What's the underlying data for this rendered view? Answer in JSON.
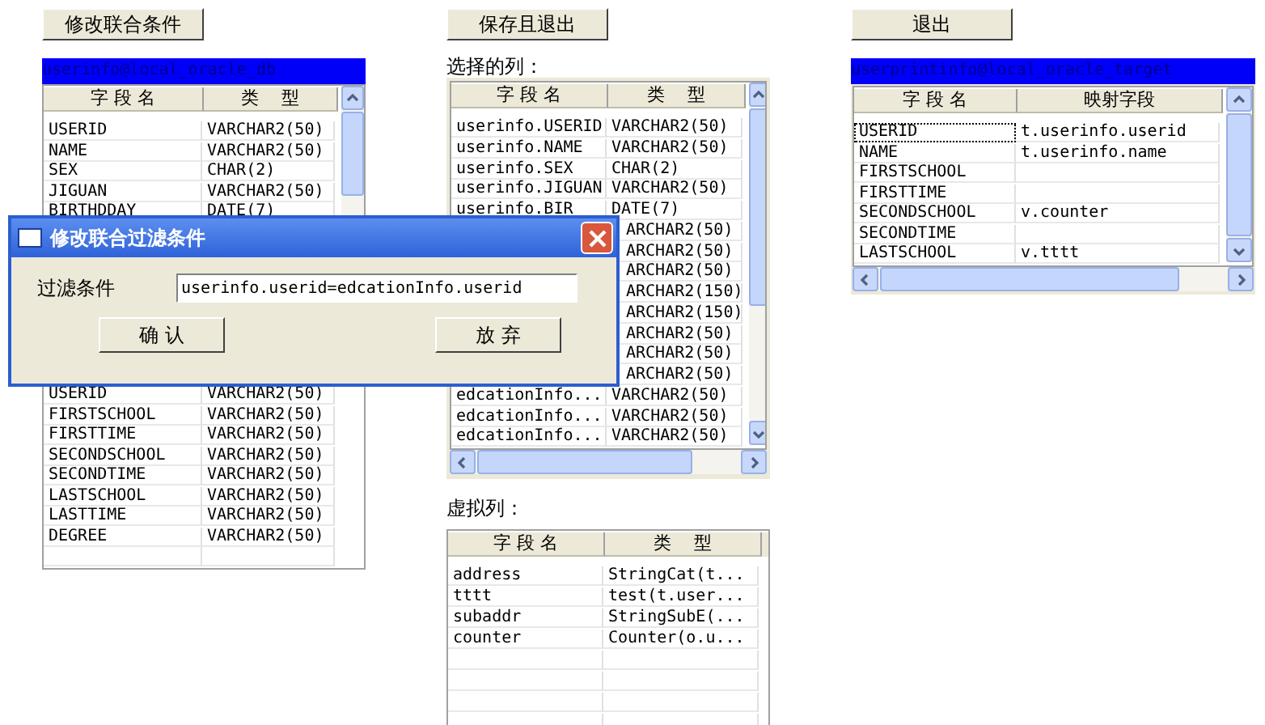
{
  "buttons": [
    {
      "label": "修改联合条件"
    },
    {
      "label": "保存且退出"
    },
    {
      "label": "退出"
    }
  ],
  "source_table": {
    "title": "userinfo@local_oracle_db",
    "columns": [
      "字 段 名",
      "类　 型"
    ],
    "rows_top": [
      {
        "name": "USERID",
        "type": "VARCHAR2(50)"
      },
      {
        "name": "NAME",
        "type": "VARCHAR2(50)"
      },
      {
        "name": "SEX",
        "type": "CHAR(2)"
      },
      {
        "name": "JIGUAN",
        "type": "VARCHAR2(50)"
      },
      {
        "name": "BIRTHDDAY",
        "type": "DATE(7)"
      }
    ],
    "rows_bottom": [
      {
        "name": "USERID",
        "type": "VARCHAR2(50)"
      },
      {
        "name": "FIRSTSCHOOL",
        "type": "VARCHAR2(50)"
      },
      {
        "name": "FIRSTTIME",
        "type": "VARCHAR2(50)"
      },
      {
        "name": "SECONDSCHOOL",
        "type": "VARCHAR2(50)"
      },
      {
        "name": "SECONDTIME",
        "type": "VARCHAR2(50)"
      },
      {
        "name": "LASTSCHOOL",
        "type": "VARCHAR2(50)"
      },
      {
        "name": "LASTTIME",
        "type": "VARCHAR2(50)"
      },
      {
        "name": "DEGREE",
        "type": "VARCHAR2(50)"
      }
    ]
  },
  "selected_columns": {
    "label": "选择的列：",
    "columns": [
      "字 段 名",
      "类　 型"
    ],
    "rows": [
      {
        "name": "userinfo.USERID",
        "type": "VARCHAR2(50)"
      },
      {
        "name": "userinfo.NAME",
        "type": "VARCHAR2(50)"
      },
      {
        "name": "userinfo.SEX",
        "type": "CHAR(2)"
      },
      {
        "name": "userinfo.JIGUAN",
        "type": "VARCHAR2(50)"
      },
      {
        "name": "userinfo.BIR",
        "type": "DATE(7)"
      },
      {
        "type": "ARCHAR2(50)"
      },
      {
        "type": "ARCHAR2(50)"
      },
      {
        "type": "ARCHAR2(50)"
      },
      {
        "type": "ARCHAR2(150)"
      },
      {
        "type": "ARCHAR2(150)"
      },
      {
        "type": "ARCHAR2(50)"
      },
      {
        "type": "ARCHAR2(50)"
      },
      {
        "type": "ARCHAR2(50)"
      },
      {
        "name": "edcationInfo...",
        "type": "VARCHAR2(50)"
      },
      {
        "name": "edcationInfo...",
        "type": "VARCHAR2(50)"
      },
      {
        "name": "edcationInfo...",
        "type": "VARCHAR2(50)"
      }
    ]
  },
  "virtual_columns": {
    "label": "虚拟列：",
    "columns": [
      "字 段 名",
      "类　 型"
    ],
    "rows": [
      {
        "name": "address",
        "type": "StringCat(t..."
      },
      {
        "name": "tttt",
        "type": "test(t.user..."
      },
      {
        "name": "subaddr",
        "type": "StringSubE(..."
      },
      {
        "name": "counter",
        "type": "Counter(o.u..."
      }
    ]
  },
  "target_table": {
    "title": "userprintinfo@local_oracle_target",
    "columns": [
      "字 段 名",
      "映射字段"
    ],
    "rows": [
      {
        "name": "USERID",
        "mapping": "t.userinfo.userid",
        "selected": true
      },
      {
        "name": "NAME",
        "mapping": "t.userinfo.name",
        "selected": false
      },
      {
        "name": "FIRSTSCHOOL",
        "selected": false
      },
      {
        "name": "FIRSTTIME",
        "selected": false
      },
      {
        "name": "SECONDSCHOOL",
        "mapping": "v.counter",
        "selected": false
      },
      {
        "name": "SECONDTIME",
        "selected": false
      },
      {
        "name": "LASTSCHOOL",
        "mapping": "v.tttt",
        "selected": false
      }
    ]
  },
  "dialog": {
    "title": "修改联合过滤条件",
    "field_label": "过滤条件",
    "field_value": "userinfo.userid=edcationInfo.userid",
    "buttons": [
      "确 认",
      "放 弃"
    ]
  }
}
